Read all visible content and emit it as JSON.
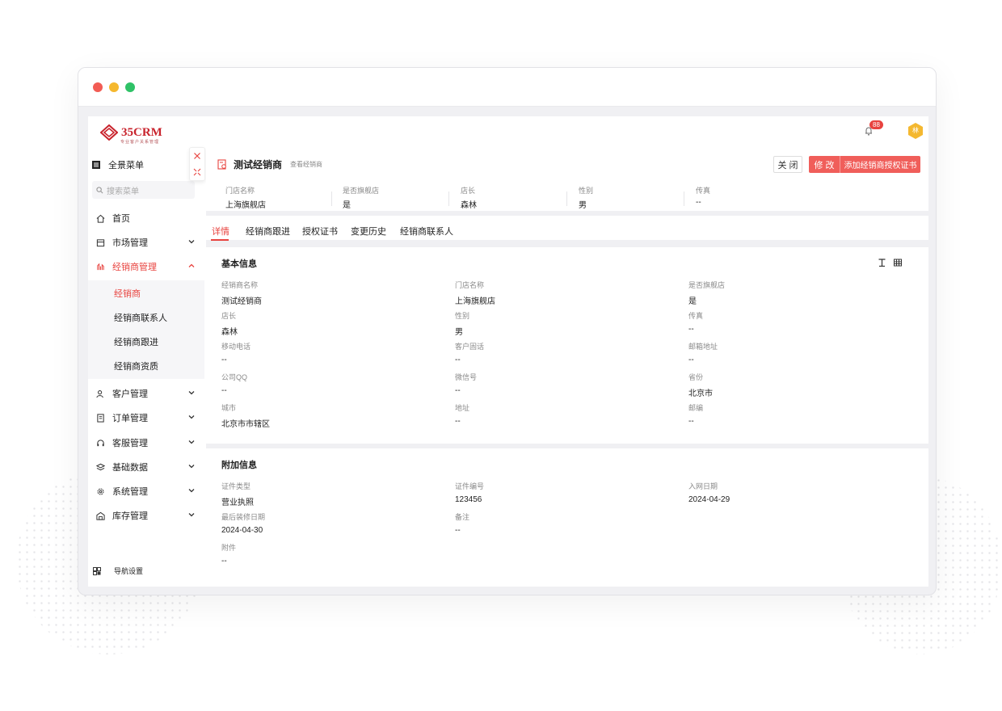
{
  "brand": {
    "name": "35CRM",
    "tagline": "专业客户关系管理",
    "accent": "#e8433f",
    "button": "#f05e5a"
  },
  "sidebar": {
    "menu_label": "全景菜单",
    "search_placeholder": "搜索菜单",
    "items": [
      {
        "label": "首页",
        "icon": "home-icon"
      },
      {
        "label": "市场管理",
        "icon": "store-icon"
      },
      {
        "label": "经销商管理",
        "icon": "dealer-icon"
      },
      {
        "label": "客户管理",
        "icon": "user-icon"
      },
      {
        "label": "订单管理",
        "icon": "document-icon"
      },
      {
        "label": "客服管理",
        "icon": "headset-icon"
      },
      {
        "label": "基础数据",
        "icon": "layers-icon"
      },
      {
        "label": "系统管理",
        "icon": "gear-icon"
      },
      {
        "label": "库存管理",
        "icon": "warehouse-icon"
      }
    ],
    "subitems": [
      {
        "label": "经销商"
      },
      {
        "label": "经销商联系人"
      },
      {
        "label": "经销商跟进"
      },
      {
        "label": "经销商资质"
      }
    ],
    "settings_label": "导航设置"
  },
  "topbar": {
    "notification_count": "88",
    "avatar_text": "林"
  },
  "page": {
    "title": "测试经销商",
    "subtitle": "查看经销商",
    "close_label": "关 闭",
    "edit_label": "修 改",
    "add_license_label": "添加经销商授权证书"
  },
  "summary": [
    {
      "key": "门店名称",
      "value": "上海旗舰店"
    },
    {
      "key": "是否旗舰店",
      "value": "是"
    },
    {
      "key": "店长",
      "value": "森林"
    },
    {
      "key": "性别",
      "value": "男"
    },
    {
      "key": "传真",
      "value": "--"
    }
  ],
  "tabs": [
    {
      "label": "详情"
    },
    {
      "label": "经销商跟进"
    },
    {
      "label": "授权证书"
    },
    {
      "label": "变更历史"
    },
    {
      "label": "经销商联系人"
    }
  ],
  "basic": {
    "title": "基本信息",
    "fields": [
      {
        "key": "经销商名称",
        "value": "测试经销商"
      },
      {
        "key": "门店名称",
        "value": "上海旗舰店"
      },
      {
        "key": "是否旗舰店",
        "value": "是"
      },
      {
        "key": "店长",
        "value": "森林"
      },
      {
        "key": "性别",
        "value": "男"
      },
      {
        "key": "传真",
        "value": "--"
      },
      {
        "key": "移动电话",
        "value": "--"
      },
      {
        "key": "客户固话",
        "value": "--"
      },
      {
        "key": "邮箱地址",
        "value": "--"
      },
      {
        "key": "公司QQ",
        "value": "--"
      },
      {
        "key": "微信号",
        "value": "--"
      },
      {
        "key": "省份",
        "value": "北京市"
      },
      {
        "key": "城市",
        "value": "北京市市辖区"
      },
      {
        "key": "地址",
        "value": "--"
      },
      {
        "key": "邮编",
        "value": "--"
      }
    ]
  },
  "extra": {
    "title": "附加信息",
    "fields": [
      {
        "key": "证件类型",
        "value": "营业执照"
      },
      {
        "key": "证件编号",
        "value": "123456"
      },
      {
        "key": "入网日期",
        "value": "2024-04-29"
      },
      {
        "key": "最后装修日期",
        "value": "2024-04-30"
      },
      {
        "key": "备注",
        "value": "--"
      },
      {
        "key": "附件",
        "value": "--"
      }
    ]
  }
}
